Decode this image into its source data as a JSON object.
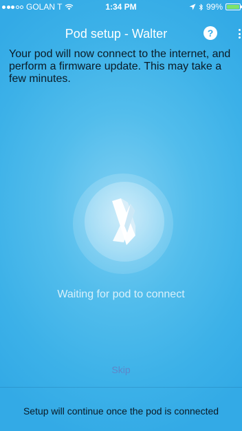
{
  "status_bar": {
    "carrier": "GOLAN T",
    "time": "1:34 PM",
    "battery_percent": "99%",
    "battery_level": 0.99,
    "signal_bars_filled": 3,
    "signal_bars_total": 5,
    "icons": [
      "wifi-icon",
      "location-arrow-icon",
      "bluetooth-icon",
      "battery-icon"
    ]
  },
  "header": {
    "title": "Pod setup - Walter",
    "help_label": "?"
  },
  "description": "Your pod will now connect to the internet, and perform a firmware update. This may take a few minutes.",
  "status_message": "Waiting for pod to connect",
  "skip_label": "Skip",
  "footer_message": "Setup will continue once the pod is connected",
  "colors": {
    "background": "#3cb1e8",
    "battery_fill": "#7ee36a",
    "skip_link": "#5e86c9",
    "dark_text": "#0a1a26"
  }
}
